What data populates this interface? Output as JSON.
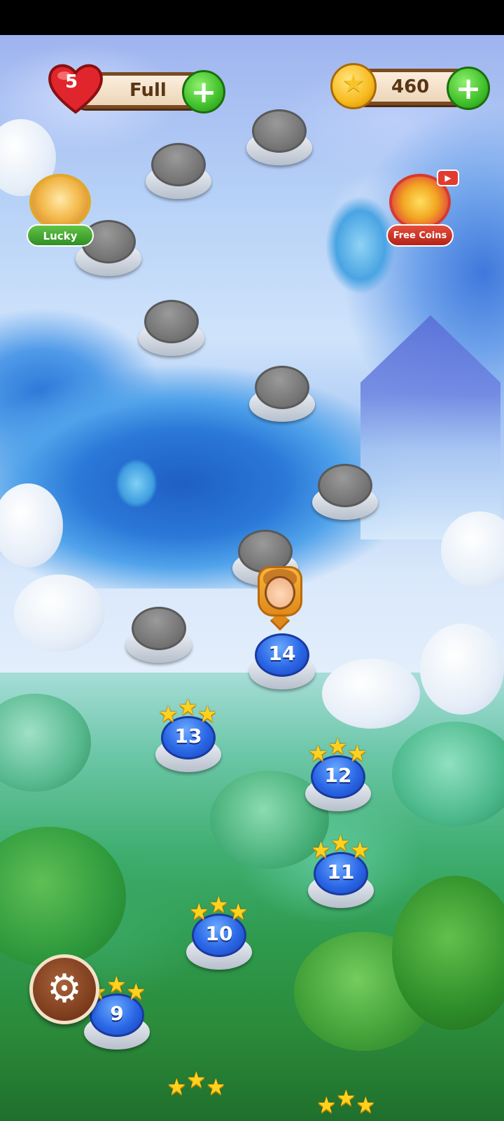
{
  "hud": {
    "lives": {
      "count": "5",
      "status": "Full",
      "add_label": "+"
    },
    "coins": {
      "amount": "460",
      "add_label": "+"
    }
  },
  "side_buttons": {
    "lucky": {
      "label": "Lucky"
    },
    "free_coins": {
      "label": "Free Coins",
      "badge": "▶"
    }
  },
  "levels": [
    {
      "number": "14",
      "stars": 0,
      "state": "current"
    },
    {
      "number": "13",
      "stars": 3,
      "state": "completed"
    },
    {
      "number": "12",
      "stars": 3,
      "state": "completed"
    },
    {
      "number": "11",
      "stars": 3,
      "state": "completed"
    },
    {
      "number": "10",
      "stars": 3,
      "state": "completed"
    },
    {
      "number": "9",
      "stars": 3,
      "state": "completed"
    }
  ],
  "locked_level_count": 8,
  "settings": {
    "icon": "gear-icon"
  },
  "colors": {
    "heart": "#e0262c",
    "plus_button": "#3fbf2a",
    "coin": "#f8b91d",
    "level_open": "#2a67e6",
    "level_locked": "#7a7a7a",
    "star": "#ffd21e"
  }
}
